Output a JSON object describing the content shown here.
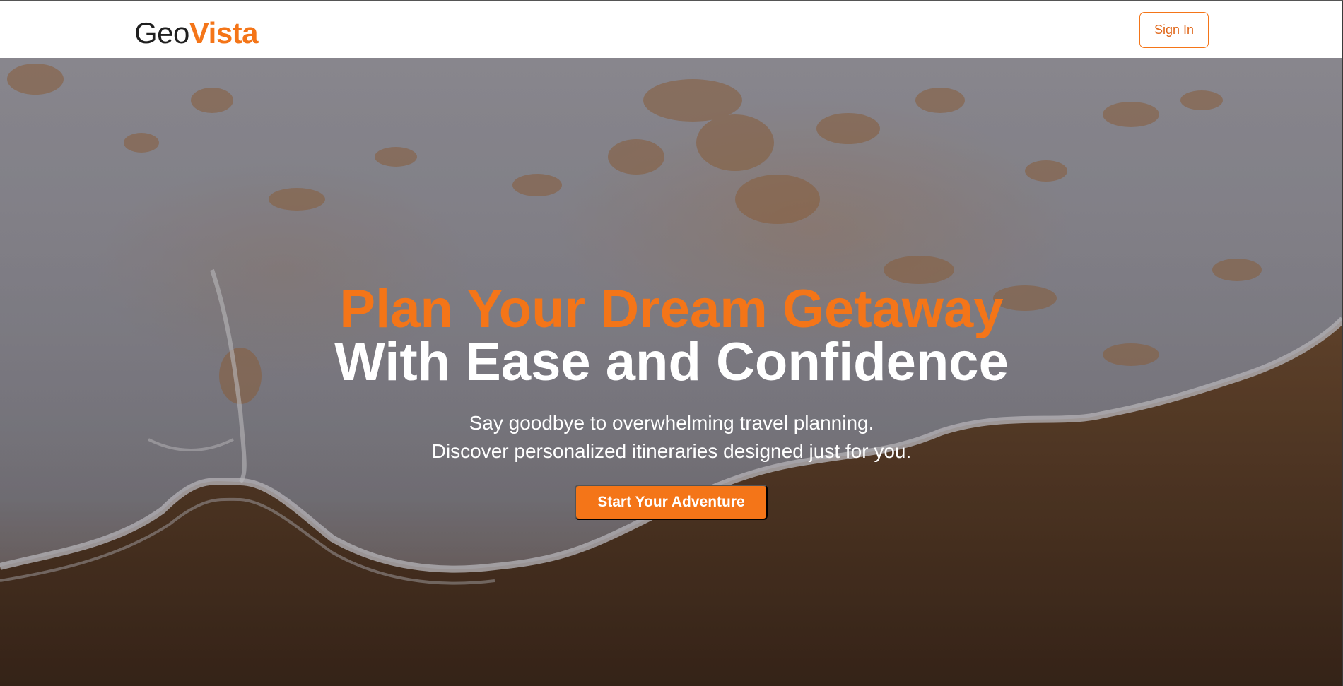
{
  "header": {
    "logo_geo": "Geo",
    "logo_vista": "Vista",
    "signin_label": "Sign In"
  },
  "hero": {
    "headline_line1": "Plan Your Dream Getaway",
    "headline_line2": "With Ease and Confidence",
    "subtitle_line1": "Say goodbye to overwhelming travel planning.",
    "subtitle_line2": "Discover personalized itineraries designed just for you.",
    "cta_label": "Start Your Adventure",
    "background_image": "aerial-beach-waves-photo"
  },
  "colors": {
    "accent": "#f47518",
    "header_bg": "#ffffff",
    "text_light": "#ffffff",
    "text_dark": "#1f1f1f"
  }
}
